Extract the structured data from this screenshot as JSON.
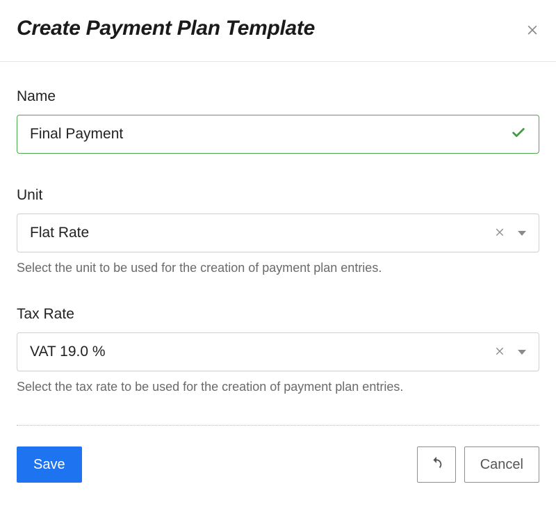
{
  "header": {
    "title": "Create Payment Plan Template"
  },
  "fields": {
    "name": {
      "label": "Name",
      "value": "Final Payment"
    },
    "unit": {
      "label": "Unit",
      "value": "Flat Rate",
      "help": "Select the unit to be used for the creation of payment plan entries."
    },
    "tax_rate": {
      "label": "Tax Rate",
      "value": "VAT 19.0 %",
      "help": "Select the tax rate to be used for the creation of payment plan entries."
    }
  },
  "footer": {
    "save_label": "Save",
    "cancel_label": "Cancel"
  }
}
